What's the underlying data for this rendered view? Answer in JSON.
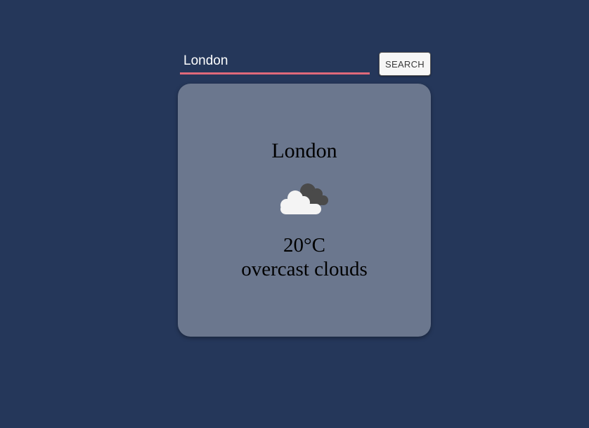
{
  "search": {
    "value": "London",
    "button_label": "SEARCH"
  },
  "weather": {
    "city": "London",
    "icon": "overcast-clouds-icon",
    "temperature": "20°C",
    "description": "overcast clouds"
  },
  "colors": {
    "background": "#25375a",
    "card": "#6b778e",
    "input_underline": "#e0697a"
  }
}
